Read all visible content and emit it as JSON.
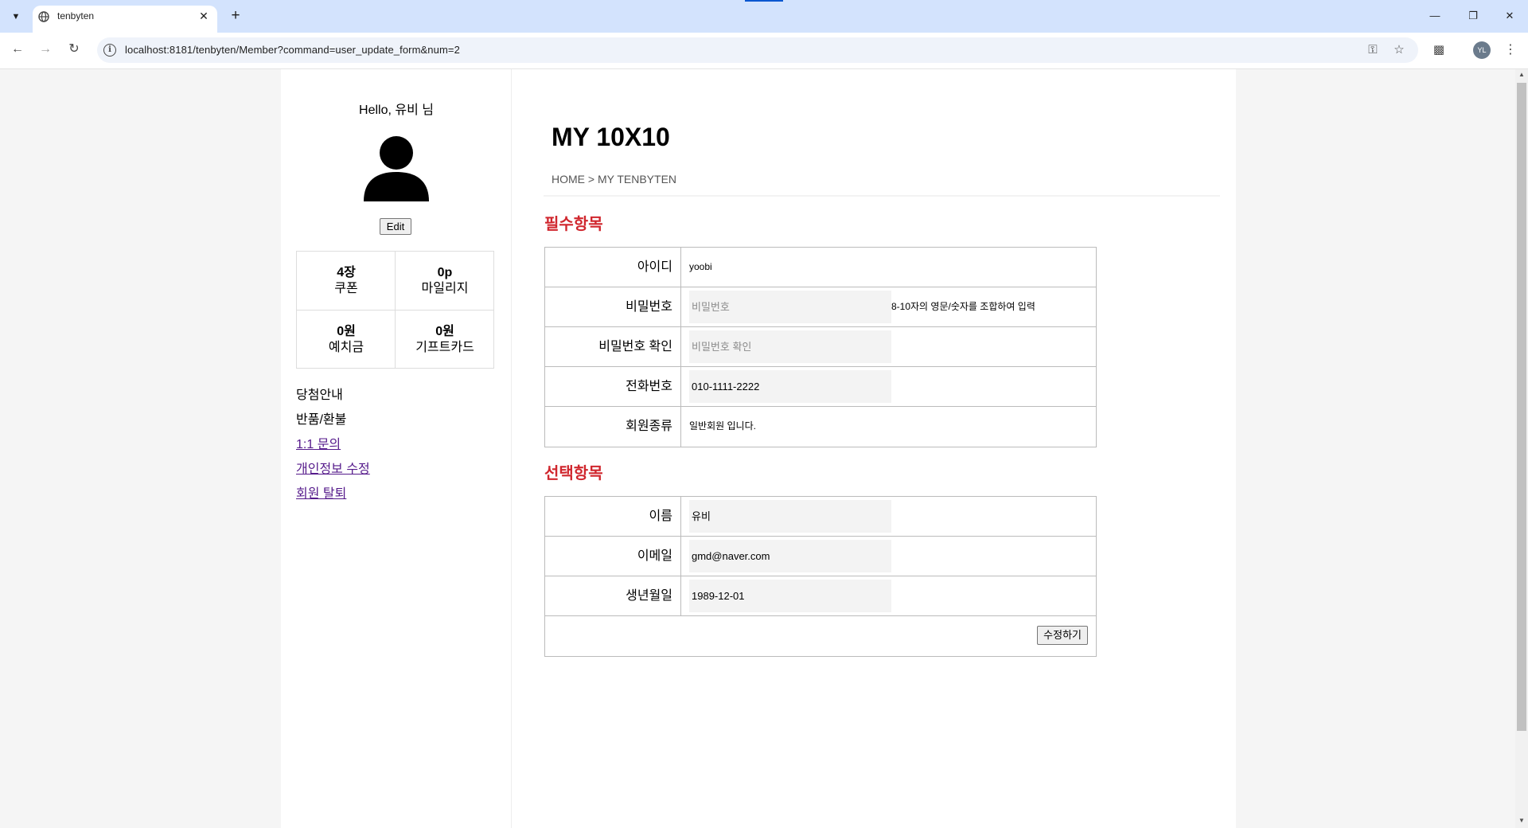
{
  "browser": {
    "tab_title": "tenbyten",
    "url": "localhost:8181/tenbyten/Member?command=user_update_form&num=2",
    "profile_initials": "YL"
  },
  "sidebar": {
    "greeting": "Hello, 유비 님",
    "edit_label": "Edit",
    "stats": [
      {
        "value": "4장",
        "label": "쿠폰"
      },
      {
        "value": "0p",
        "label": "마일리지"
      },
      {
        "value": "0원",
        "label": "예치금"
      },
      {
        "value": "0원",
        "label": "기프트카드"
      }
    ],
    "menu": [
      {
        "label": "당첨안내",
        "link": false
      },
      {
        "label": "반품/환불",
        "link": false
      },
      {
        "label": "1:1 문의",
        "link": true
      },
      {
        "label": "개인정보 수정",
        "link": true
      },
      {
        "label": "회원 탈퇴",
        "link": true
      }
    ]
  },
  "main": {
    "title": "MY 10X10",
    "breadcrumb": "HOME > MY TENBYTEN",
    "required": {
      "heading": "필수항목",
      "id_label": "아이디",
      "id_value": "yoobi",
      "pw_label": "비밀번호",
      "pw_placeholder": "비밀번호",
      "pw_hint": "8-10자의 영문/숫자를 조합하여 입력",
      "pw_confirm_label": "비밀번호 확인",
      "pw_confirm_placeholder": "비밀번호 확인",
      "phone_label": "전화번호",
      "phone_value": "010-1111-2222",
      "type_label": "회원종류",
      "type_value": "일반회원 입니다."
    },
    "optional": {
      "heading": "선택항목",
      "name_label": "이름",
      "name_value": "유비",
      "email_label": "이메일",
      "email_value": "gmd@naver.com",
      "birth_label": "생년월일",
      "birth_value": "1989-12-01"
    },
    "submit_label": "수정하기"
  }
}
